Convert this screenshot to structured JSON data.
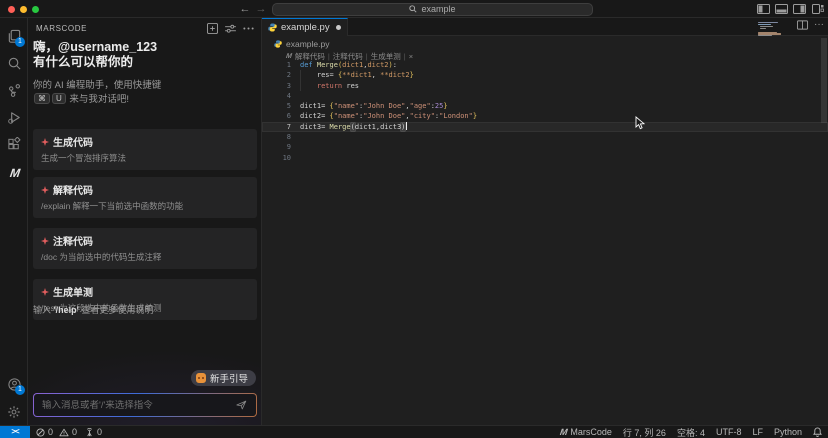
{
  "window": {
    "search_value": "example",
    "nav_back": "←",
    "nav_forward": "→"
  },
  "activity_bar": {
    "explorer_badge": "1",
    "accounts_badge": "1"
  },
  "sidebar": {
    "title": "MARSCODE",
    "greeting_line1": "嗨，@username_123",
    "greeting_line2": "有什么可以帮你的",
    "subtitle_line1": "你的 AI 编程助手，使用快捷键",
    "shortcut_keys": [
      "⌘",
      "U"
    ],
    "subtitle_line2_suffix": "来与我对话吧!",
    "cards": [
      {
        "title": "生成代码",
        "desc": "生成一个冒泡排序算法"
      },
      {
        "title": "解释代码",
        "desc": "/explain 解释一下当前选中函数的功能"
      },
      {
        "title": "注释代码",
        "desc": "/doc 为当前选中的代码生成注释"
      },
      {
        "title": "生成单测",
        "desc": "/test 为这段选中的函数生成单测"
      }
    ],
    "hint_prefix": "输入 ",
    "hint_code": "'/help'",
    "hint_suffix": " 查看更多使用说明",
    "onboarding_button": "新手引导",
    "input_placeholder": "输入消息或者'/'来选择指令"
  },
  "editor": {
    "tab_label": "example.py",
    "breadcrumb": "example.py",
    "codelens_items": [
      "解释代码",
      "注释代码",
      "生成单测"
    ],
    "codelens_close": "×",
    "lines": [
      {
        "n": "1",
        "tokens": [
          [
            "kw",
            "def "
          ],
          [
            "fn",
            "Merge"
          ],
          [
            "br",
            "("
          ],
          [
            "pm",
            "dict1"
          ],
          [
            "pl",
            ","
          ],
          [
            "pm",
            "dict2"
          ],
          [
            "br",
            ")"
          ],
          [
            "pl",
            ":"
          ]
        ]
      },
      {
        "n": "2",
        "tokens": [
          [
            "pl",
            "    res= "
          ],
          [
            "br",
            "{"
          ],
          [
            "pm",
            "**dict1"
          ],
          [
            "pl",
            ", "
          ],
          [
            "pm",
            "**dict2"
          ],
          [
            "br",
            "}"
          ]
        ]
      },
      {
        "n": "3",
        "tokens": [
          [
            "pl",
            "    "
          ],
          [
            "rt",
            "return"
          ],
          [
            "pl",
            " res"
          ]
        ]
      },
      {
        "n": "4",
        "tokens": []
      },
      {
        "n": "5",
        "tokens": [
          [
            "pl",
            "dict1= "
          ],
          [
            "br",
            "{"
          ],
          [
            "st",
            "\"name\""
          ],
          [
            "pl",
            ":"
          ],
          [
            "st",
            "\"John Doe\""
          ],
          [
            "pl",
            ","
          ],
          [
            "st",
            "\"age\""
          ],
          [
            "pl",
            ":"
          ],
          [
            "nu",
            "25"
          ],
          [
            "br",
            "}"
          ]
        ]
      },
      {
        "n": "6",
        "tokens": [
          [
            "pl",
            "dict2= "
          ],
          [
            "br",
            "{"
          ],
          [
            "st",
            "\"name\""
          ],
          [
            "pl",
            ":"
          ],
          [
            "st",
            "\"John Doe\""
          ],
          [
            "pl",
            ","
          ],
          [
            "st",
            "\"city\""
          ],
          [
            "pl",
            ":"
          ],
          [
            "st",
            "\"London\""
          ],
          [
            "br",
            "}"
          ]
        ]
      },
      {
        "n": "7",
        "active": true,
        "tokens": [
          [
            "pl",
            "dict3= "
          ],
          [
            "fn",
            "Merge"
          ],
          [
            "bh",
            "("
          ],
          [
            "pl",
            "dict1,dict3"
          ],
          [
            "bh",
            ")"
          ],
          [
            "cu",
            ""
          ]
        ]
      },
      {
        "n": "8",
        "tokens": []
      },
      {
        "n": "9",
        "tokens": []
      },
      {
        "n": "10",
        "tokens": []
      }
    ]
  },
  "status_bar": {
    "remote_indicator": "><",
    "errors": "0",
    "warnings": "0",
    "ports": "0",
    "brand": "MarsCode",
    "cursor_position": "行 7, 列 26",
    "indentation": "空格: 4",
    "encoding": "UTF-8",
    "eol": "LF",
    "language": "Python"
  },
  "colors": {
    "accent_blue": "#0078d4",
    "keyword": "#569cd6",
    "function": "#dcdcaa",
    "parameter": "#d19a66",
    "string": "#ce9178",
    "number": "#a88bd4",
    "bracket": "#e2c05c",
    "return_keyword": "#d1766a",
    "card_spark": "#e05d5d",
    "traffic_red": "#ff5f57",
    "traffic_yellow": "#febc2e",
    "traffic_green": "#28c840",
    "mascot_orange": "#e8923a"
  }
}
